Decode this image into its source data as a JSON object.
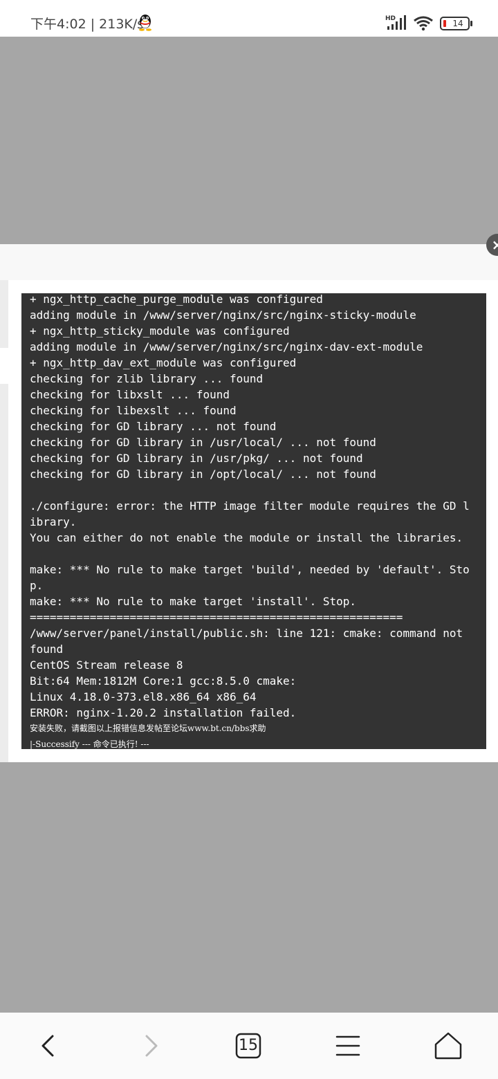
{
  "status_bar": {
    "time": "下午4:02",
    "speed": "213K/s",
    "network": "HD",
    "battery": "14",
    "icons": [
      "qq-icon",
      "signal-icon",
      "wifi-icon",
      "battery-icon"
    ]
  },
  "modal": {
    "close_icon": "close-icon",
    "terminal_lines": [
      "+ ngx_http_cache_purge_module was configured",
      "adding module in /www/server/nginx/src/nginx-sticky-module",
      "+ ngx_http_sticky_module was configured",
      "adding module in /www/server/nginx/src/nginx-dav-ext-module",
      "+ ngx_http_dav_ext_module was configured",
      "checking for zlib library ... found",
      "checking for libxslt ... found",
      "checking for libexslt ... found",
      "checking for GD library ... not found",
      "checking for GD library in /usr/local/ ... not found",
      "checking for GD library in /usr/pkg/ ... not found",
      "checking for GD library in /opt/local/ ... not found",
      "",
      "./configure: error: the HTTP image filter module requires the GD l",
      "ibrary.",
      "You can either do not enable the module or install the libraries.",
      "",
      "make: *** No rule to make target 'build', needed by 'default'. Sto",
      "p.",
      "make: *** No rule to make target 'install'. Stop.",
      "========================================================",
      "/www/server/panel/install/public.sh: line 121: cmake: command not",
      "found",
      "CentOS Stream release 8",
      "Bit:64 Mem:1812M Core:1 gcc:8.5.0 cmake:",
      "Linux 4.18.0-373.el8.x86_64 x86_64",
      "ERROR: nginx-1.20.2 installation failed.",
      "安装失败，请截图以上报错信息发帖至论坛www.bt.cn/bbs求助",
      "|-Successify --- 命令已执行! ---"
    ]
  },
  "nav": {
    "back_icon": "back-icon",
    "forward_icon": "forward-icon",
    "tabs_count": "15",
    "menu_icon": "menu-icon",
    "home_icon": "home-icon"
  }
}
